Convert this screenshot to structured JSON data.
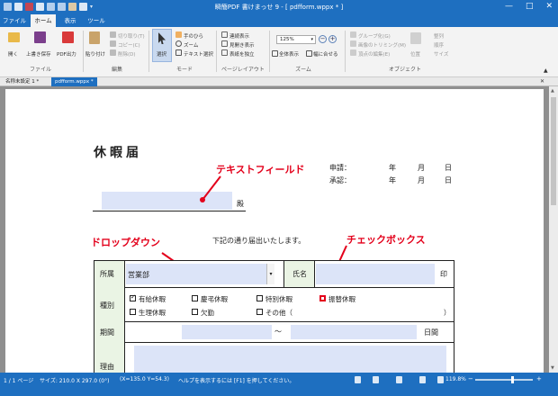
{
  "app": {
    "title": "瞬簡PDF 書けまっせ 9 - [ pdfform.wppx * ]",
    "window_controls": [
      "—",
      "□",
      "✕"
    ]
  },
  "menu_tabs": [
    {
      "label": "ファイル",
      "active": false
    },
    {
      "label": "ホーム",
      "active": true
    },
    {
      "label": "表示",
      "active": false
    },
    {
      "label": "ツール",
      "active": false
    }
  ],
  "ribbon": {
    "file_group": {
      "open": "開く",
      "overwrite_save": "上書き保存",
      "pdf_output": "PDF出力",
      "label": "ファイル"
    },
    "edit_group": {
      "paste": "貼り付け",
      "cut": "切り取り(T)",
      "copy": "コピー(C)",
      "delete": "削除(D)",
      "label": "編集"
    },
    "mode_group": {
      "select": "選択",
      "hand": "手のひら",
      "zoom": "ズーム",
      "text_select": "テキスト選択",
      "label": "モード"
    },
    "layout_group": {
      "continuous": "連続表示",
      "spread": "見開き表示",
      "cover_single": "表紙を独立",
      "label": "ページレイアウト"
    },
    "zoom_group": {
      "zoom_value": "125%",
      "whole_page": "全体表示",
      "fit_width": "幅に合せる",
      "label": "ズーム"
    },
    "object_group": {
      "group": "グループ化(G)",
      "image_trim": "画像のトリミング(M)",
      "vertex_edit": "頂点の編集(E)",
      "position": "位置",
      "align": "整列",
      "order": "順序",
      "size": "サイズ",
      "label": "オブジェクト"
    }
  },
  "doc_tabs": [
    {
      "label": "名称未設定 1 *",
      "active": false
    },
    {
      "label": "pdfform.wppx *",
      "active": true
    }
  ],
  "document": {
    "title": "休暇届",
    "apply_label": "申請：",
    "approve_label": "承認：",
    "year": "年",
    "month": "月",
    "day": "日",
    "addressee_suffix": "殿",
    "notice": "下記の通り届出いたします。",
    "dept_label": "所属",
    "dept_value": "営業部",
    "name_label": "氏名",
    "seal": "印",
    "type_label": "種別",
    "types_row1": [
      {
        "label": "有給休暇",
        "checked": true
      },
      {
        "label": "慶弔休暇",
        "checked": false
      },
      {
        "label": "特別休暇",
        "checked": false
      },
      {
        "label": "振替休暇",
        "checked": false
      }
    ],
    "types_row2": [
      {
        "label": "生理休暇",
        "checked": false
      },
      {
        "label": "欠勤",
        "checked": false
      },
      {
        "label": "その他（",
        "checked": false
      }
    ],
    "other_close": "）",
    "period_label": "期間",
    "period_sep": "～",
    "days_label": "日間",
    "reason_label": "理由"
  },
  "annotations": {
    "text_field": "テキストフィールド",
    "dropdown": "ドロップダウン",
    "checkbox": "チェックボックス"
  },
  "colors": {
    "accent": "#1e6fc0",
    "annotation": "#e3001b",
    "field_fill": "#dce4f8"
  },
  "status": {
    "page": "1 / 1 ページ",
    "size": "サイズ: 210.0 X 297.0 (0°)",
    "coords": "(X=135.0 Y=54.3)",
    "help": "ヘルプを表示するには [F1] を押してください。",
    "zoom": "119.8%"
  }
}
